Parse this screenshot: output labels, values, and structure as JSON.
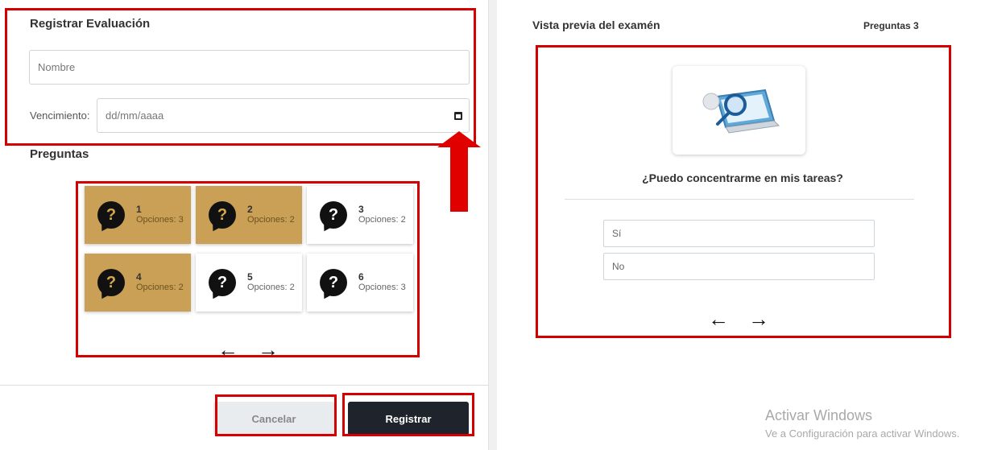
{
  "left": {
    "title": "Registrar Evaluación",
    "name_placeholder": "Nombre",
    "due_label": "Vencimiento:",
    "due_placeholder": "dd/mm/aaaa",
    "questions_title": "Preguntas",
    "questions": [
      {
        "num": "1",
        "options": "Opciones: 3",
        "active": true
      },
      {
        "num": "2",
        "options": "Opciones: 2",
        "active": true
      },
      {
        "num": "3",
        "options": "Opciones: 2",
        "active": false
      },
      {
        "num": "4",
        "options": "Opciones: 2",
        "active": true
      },
      {
        "num": "5",
        "options": "Opciones: 2",
        "active": false
      },
      {
        "num": "6",
        "options": "Opciones: 3",
        "active": false
      }
    ],
    "nav": {
      "prev": "←",
      "next": "→"
    },
    "cancel_label": "Cancelar",
    "register_label": "Registrar"
  },
  "right": {
    "title": "Vista previa del examén",
    "count": "Preguntas 3",
    "question": "¿Puedo concentrarme en mis tareas?",
    "options": [
      "Sí",
      "No"
    ],
    "nav": {
      "prev": "←",
      "next": "→"
    }
  },
  "watermark": {
    "line1": "Activar Windows",
    "line2": "Ve a Configuración para activar Windows."
  },
  "colors": {
    "highlight": "#d40000",
    "active_card": "#c9a055",
    "primary_button": "#1f232b"
  }
}
